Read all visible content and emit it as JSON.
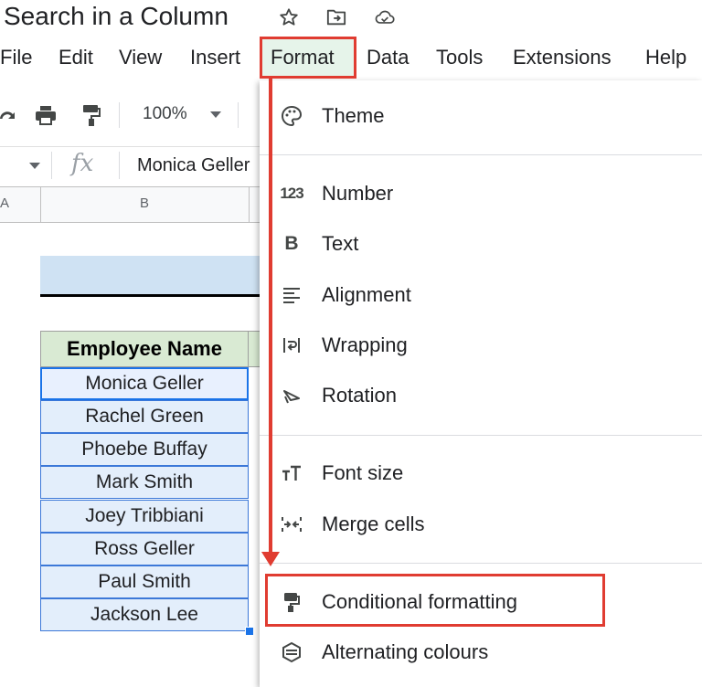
{
  "title_bar": {
    "doc_title": "Search in a Column",
    "icons": [
      "star-icon",
      "move-to-folder-icon",
      "cloud-saved-icon"
    ]
  },
  "menu": {
    "items": [
      "File",
      "Edit",
      "View",
      "Insert",
      "Format",
      "Data",
      "Tools",
      "Extensions",
      "Help"
    ],
    "active": "Format"
  },
  "toolbar": {
    "zoom": "100%"
  },
  "formula_bar": {
    "fx": "fx",
    "value": "Monica Geller"
  },
  "columns": {
    "a": "A",
    "b": "B"
  },
  "sheet": {
    "header": "Employee Name",
    "names": [
      "Monica Geller",
      "Rachel Green",
      "Phoebe Buffay",
      "Mark Smith",
      "Joey Tribbiani",
      "Ross Geller",
      "Paul Smith",
      "Jackson Lee"
    ]
  },
  "format_menu": {
    "items": [
      {
        "label": "Theme",
        "icon": "palette-icon"
      },
      {
        "label": "Number",
        "icon": "number-123-icon"
      },
      {
        "label": "Text",
        "icon": "bold-b-icon"
      },
      {
        "label": "Alignment",
        "icon": "align-left-icon"
      },
      {
        "label": "Wrapping",
        "icon": "wrap-text-icon"
      },
      {
        "label": "Rotation",
        "icon": "text-rotation-icon"
      },
      {
        "label": "Font size",
        "icon": "font-size-icon"
      },
      {
        "label": "Merge cells",
        "icon": "merge-cells-icon"
      },
      {
        "label": "Conditional formatting",
        "icon": "paint-roller-icon"
      },
      {
        "label": "Alternating colours",
        "icon": "alternating-colours-icon"
      }
    ],
    "highlighted": "Conditional formatting"
  },
  "colors": {
    "annotation_red": "#e03c31",
    "header_green": "#d9ead3",
    "cell_blue": "#e3eefb",
    "band_blue": "#cfe2f3",
    "selection_blue": "#1a73e8"
  }
}
